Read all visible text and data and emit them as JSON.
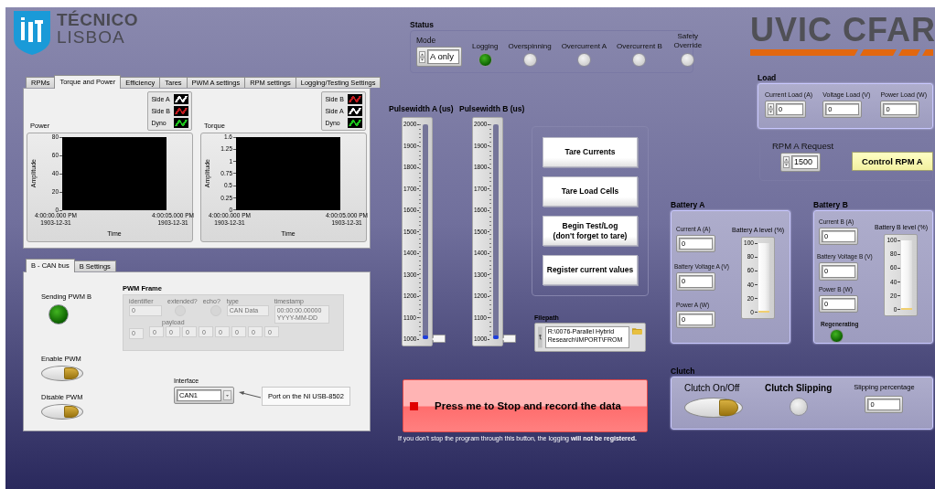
{
  "logo_left": {
    "title": "TÉCNICO",
    "subtitle": "LISBOA"
  },
  "tabs_top": [
    {
      "label": "RPMs",
      "selected": false
    },
    {
      "label": "Torque and Power",
      "selected": true
    },
    {
      "label": "Efficiency",
      "selected": false
    },
    {
      "label": "Tares",
      "selected": false
    },
    {
      "label": "PWM A settings",
      "selected": false
    },
    {
      "label": "RPM settings",
      "selected": false
    },
    {
      "label": "Logging/Testing Settings",
      "selected": false
    }
  ],
  "graphs": [
    {
      "title": "Power",
      "legend": [
        {
          "name": "Side A",
          "color": "#ffffff"
        },
        {
          "name": "Side B",
          "color": "#c0181c"
        },
        {
          "name": "Dyno",
          "color": "#1cc01c"
        }
      ],
      "ylabel": "Amplitude",
      "yticks": [
        "80",
        "60",
        "40",
        "20",
        "0"
      ],
      "xticks": [
        {
          "time": "4:00:00.000 PM",
          "date": "1903-12-31"
        },
        {
          "time": "4:00:05.000 PM",
          "date": "1903-12-31"
        }
      ],
      "xlabel": "Time"
    },
    {
      "title": "Torque",
      "legend": [
        {
          "name": "Side B",
          "color": "#c0181c"
        },
        {
          "name": "Side A",
          "color": "#ffffff"
        },
        {
          "name": "Dyno",
          "color": "#1cc01c"
        }
      ],
      "ylabel": "Amplitude",
      "yticks": [
        "1.6",
        "1.25",
        "1",
        "0.75",
        "0.5",
        "0.25",
        "0"
      ],
      "xticks": [
        {
          "time": "4:00:00.000 PM",
          "date": "1903-12-31"
        },
        {
          "time": "4:00:05.000 PM",
          "date": "1903-12-31"
        }
      ],
      "xlabel": "Time"
    }
  ],
  "tabs_bottom": [
    {
      "label": "B - CAN bus",
      "selected": true
    },
    {
      "label": "B Settings",
      "selected": false
    }
  ],
  "can": {
    "sending": {
      "label": "Sending PWM B",
      "on": true
    },
    "frame": {
      "title": "PWM Frame",
      "disabled": true,
      "identifier_label": "identifier",
      "identifier": "0",
      "extended_label": "extended?",
      "echo_label": "echo?",
      "type_label": "type",
      "type": "CAN Data",
      "timestamp_label": "timestamp",
      "timestamp": "00:00:00.00000",
      "timestamp_date": "YYYY-MM-DD",
      "payload_label": "payload",
      "payload_index": "0",
      "payload": [
        "0",
        "0",
        "0",
        "0",
        "0",
        "0",
        "0",
        "0"
      ]
    },
    "switches": [
      {
        "label": "Enable PWM",
        "on": true
      },
      {
        "label": "Disable PWM",
        "on": true
      }
    ],
    "interface": {
      "label": "Interface",
      "value": "CAN1"
    },
    "interface_note": "Port on the NI USB-8502"
  },
  "status": {
    "title": "Status",
    "mode": {
      "label": "Mode",
      "value": "A only"
    },
    "indicators": [
      {
        "label": "Logging",
        "on": true
      },
      {
        "label": "Overspinning",
        "on": false
      },
      {
        "label": "Overcurrent A",
        "on": false
      },
      {
        "label": "Overcurrent B",
        "on": false
      },
      {
        "label": "Safety Override",
        "on": false
      }
    ]
  },
  "logo_right": "UVIC CFAR",
  "pulsewidths": [
    {
      "label": "Pulsewidth A (us)",
      "level": 0,
      "ticks": [
        "2000",
        "1900",
        "1800",
        "1700",
        "1600",
        "1500",
        "1400",
        "1300",
        "1200",
        "1100",
        "1000"
      ]
    },
    {
      "label": "Pulsewidth B (us)",
      "level": 0,
      "ticks": [
        "2000",
        "1900",
        "1800",
        "1700",
        "1600",
        "1500",
        "1400",
        "1300",
        "1200",
        "1100",
        "1000"
      ]
    }
  ],
  "actions": [
    "Tare Currents",
    "Tare Load Cells",
    "Begin Test/Log\n(don't forget to tare)",
    "Register current values"
  ],
  "filepath": {
    "label": "Filepath",
    "value": "R:\\0076-Parallel Hybrid Research\\IMPORT\\FROM"
  },
  "stop_button": "Press me to Stop and record the data",
  "stop_note": "If you don't stop the program through this button, the logging **will not be registered.**",
  "load": {
    "title": "Load",
    "fields": [
      {
        "label": "Current Load (A)",
        "value": "0",
        "kind": "spin"
      },
      {
        "label": "Voltage Load (V)",
        "value": "0",
        "kind": "plain"
      },
      {
        "label": "Power Load (W)",
        "value": "0",
        "kind": "plain"
      }
    ]
  },
  "rpm_request": {
    "label": "RPM A Request",
    "value": "1500",
    "button": "Control RPM A"
  },
  "batteries": [
    {
      "title": "Battery A",
      "fields": [
        {
          "label": "Current A (A)",
          "value": "0"
        },
        {
          "label": "Battery Voltage A (V)",
          "value": "0"
        },
        {
          "label": "Power A (W)",
          "value": "0"
        }
      ],
      "level_label": "Battery A level (%)",
      "level": 0,
      "ticks": [
        "100",
        "80",
        "60",
        "40",
        "20",
        "0"
      ]
    },
    {
      "title": "Battery B",
      "fields": [
        {
          "label": "Current B (A)",
          "value": "0"
        },
        {
          "label": "Battery Voltage B (V)",
          "value": "0"
        },
        {
          "label": "Power B (W)",
          "value": "0"
        }
      ],
      "level_label": "Battery B level (%)",
      "level": 0,
      "ticks": [
        "100",
        "80",
        "60",
        "40",
        "20",
        "0"
      ],
      "regenerating": {
        "label": "Regenerating",
        "on": true
      }
    }
  ],
  "clutch": {
    "title": "Clutch",
    "switch": {
      "label": "Clutch On/Off",
      "on": true
    },
    "slipping": {
      "label": "Clutch Slipping",
      "on": false
    },
    "percentage": {
      "label": "Slipping percentage",
      "value": "0"
    }
  }
}
